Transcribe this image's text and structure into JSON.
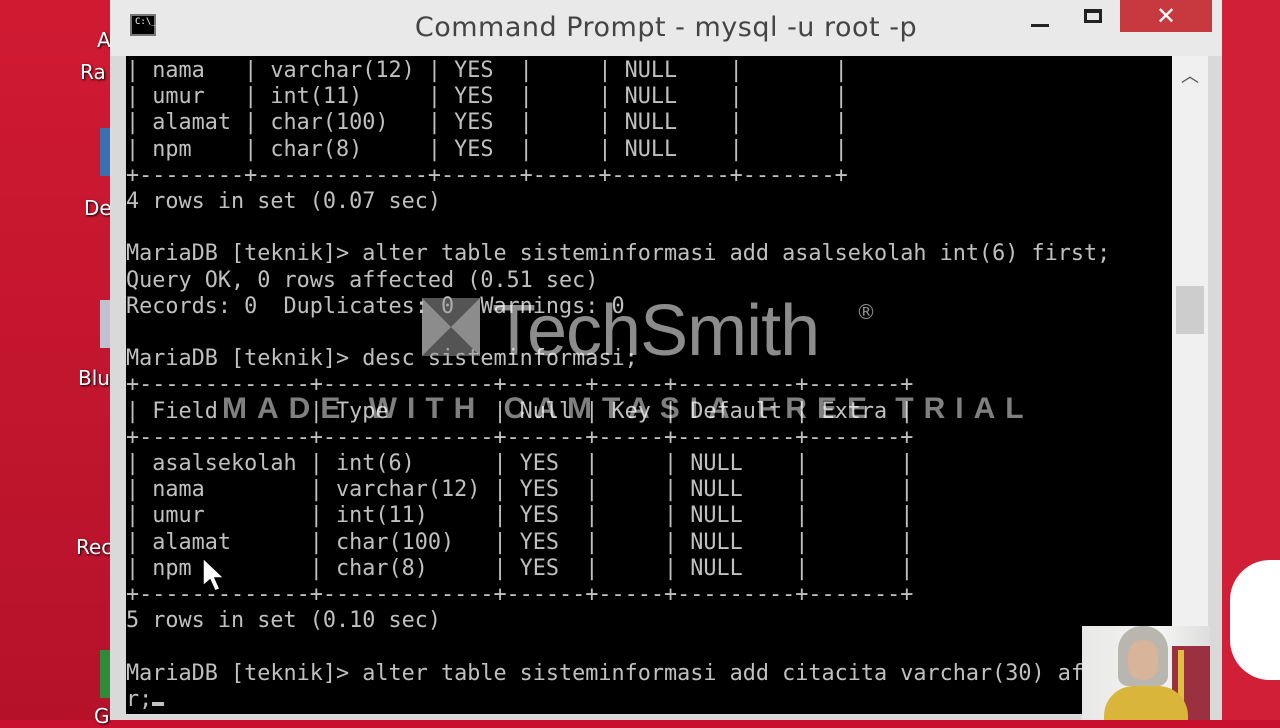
{
  "desktop": {
    "labels": [
      "A",
      "Ra",
      "De",
      "Blu",
      "Rec",
      "G"
    ]
  },
  "window": {
    "title": "Command Prompt - mysql  -u root -p",
    "icon": "console-icon",
    "controls": {
      "minimize": "minimize-icon",
      "maximize": "maximize-icon",
      "close_glyph": "✕"
    }
  },
  "console": {
    "lines": [
      "| nama   | varchar(12) | YES  |     | NULL    |       |",
      "| umur   | int(11)     | YES  |     | NULL    |       |",
      "| alamat | char(100)   | YES  |     | NULL    |       |",
      "| npm    | char(8)     | YES  |     | NULL    |       |",
      "+--------+-------------+------+-----+---------+-------+",
      "4 rows in set (0.07 sec)",
      "",
      "MariaDB [teknik]> alter table sisteminformasi add asalsekolah int(6) first;",
      "Query OK, 0 rows affected (0.51 sec)",
      "Records: 0  Duplicates: 0  Warnings: 0",
      "",
      "MariaDB [teknik]> desc sisteminformasi;",
      "+-------------+-------------+------+-----+---------+-------+",
      "| Field       | Type        | Null | Key | Default | Extra |",
      "+-------------+-------------+------+-----+---------+-------+",
      "| asalsekolah | int(6)      | YES  |     | NULL    |       |",
      "| nama        | varchar(12) | YES  |     | NULL    |       |",
      "| umur        | int(11)     | YES  |     | NULL    |       |",
      "| alamat      | char(100)   | YES  |     | NULL    |       |",
      "| npm         | char(8)     | YES  |     | NULL    |       |",
      "+-------------+-------------+------+-----+---------+-------+",
      "5 rows in set (0.10 sec)",
      "",
      "MariaDB [teknik]> alter table sisteminformasi add citacita varchar(30) af",
      "r;"
    ]
  },
  "watermark": {
    "brand": "TechSmith",
    "registered": "®",
    "caption": "MADE WITH CAMTASIA FREE TRIAL"
  },
  "colors": {
    "desktop_red": "#c8102e",
    "console_bg": "#000000",
    "console_fg": "#c0c0c0",
    "close_red": "#c7383f"
  }
}
